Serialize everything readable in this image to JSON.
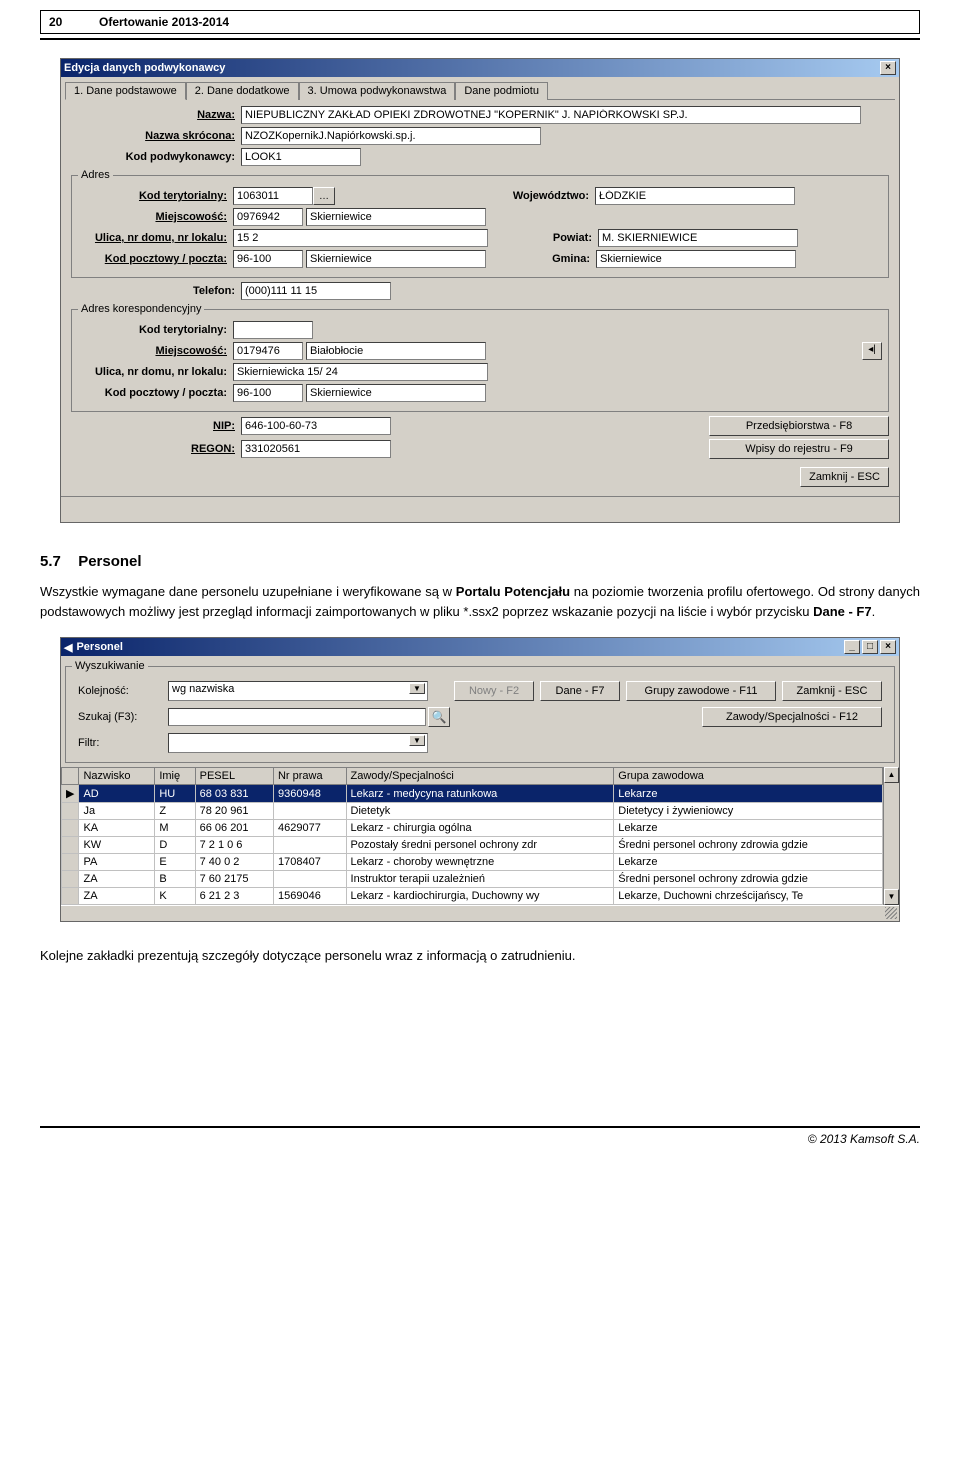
{
  "page_header": {
    "number": "20",
    "title": "Ofertowanie 2013-2014"
  },
  "win1": {
    "title": "Edycja danych podwykonawcy",
    "tabs": [
      "1. Dane podstawowe",
      "2. Dane dodatkowe",
      "3. Umowa podwykonawstwa",
      "Dane podmiotu"
    ],
    "labels": {
      "nazwa": "Nazwa:",
      "nazwa_skr": "Nazwa skrócona:",
      "kod_pod": "Kod podwykonawcy:",
      "adres": "Adres",
      "kod_ter": "Kod terytorialny:",
      "woj": "Województwo:",
      "miejsc": "Miejscowość:",
      "ulica": "Ulica, nr domu, nr lokalu:",
      "powiat": "Powiat:",
      "kod_poczta": "Kod pocztowy / poczta:",
      "gmina": "Gmina:",
      "telefon": "Telefon:",
      "adres_kor": "Adres korespondencyjny",
      "nip": "NIP:",
      "regon": "REGON:"
    },
    "values": {
      "nazwa": "NIEPUBLICZNY ZAKŁAD OPIEKI ZDROWOTNEJ \"KOPERNIK\" J. NAPIÓRKOWSKI SP.J.",
      "nazwa_skr": "NZOZKopernikJ.Napiórkowski.sp.j.",
      "kod_pod": "LOOK1",
      "kod_ter": "1063011",
      "woj": "ŁÓDZKIE",
      "miejsc_code": "0976942",
      "miejsc_name": "Skierniewice",
      "ulica": "15 2",
      "powiat": "M. SKIERNIEWICE",
      "kod_pocz": "96-100",
      "poczta": "Skierniewice",
      "gmina": "Skierniewice",
      "telefon": "(000)111 11 15",
      "kor_miejsc_code": "0179476",
      "kor_miejsc_name": "Białobłocie",
      "kor_ulica": "Skierniewicka 15/ 24",
      "kor_kod": "96-100",
      "kor_poczta": "Skierniewice",
      "nip": "646-100-60-73",
      "regon": "331020561"
    },
    "buttons": {
      "f8": "Przedsiębiorstwa - F8",
      "f9": "Wpisy do rejestru - F9",
      "esc": "Zamknij - ESC",
      "dots": "…"
    }
  },
  "section": {
    "num": "5.7",
    "title": "Personel"
  },
  "para1_a": "Wszystkie wymagane dane personelu uzupełniane i weryfikowane są w ",
  "para1_b": "Portalu Potencjału",
  "para1_c": " na poziomie tworzenia profilu ofertowego. Od strony danych podstawowych możliwy jest przegląd informacji zaimportowanych w pliku *.ssx2 poprzez wskazanie pozycji na liście i wybór przycisku ",
  "para1_d": "Dane - F7",
  "para1_e": ".",
  "win2": {
    "title": "Personel",
    "group": "Wyszukiwanie",
    "kolejnosc_lbl": "Kolejność:",
    "kolejnosc_val": "wg nazwiska",
    "szukaj_lbl": "Szukaj (F3):",
    "filtr_lbl": "Filtr:",
    "btn_nowy": "Nowy - F2",
    "btn_dane": "Dane - F7",
    "btn_grupy": "Grupy zawodowe - F11",
    "btn_zamknij": "Zamknij - ESC",
    "btn_zawody": "Zawody/Specjalności - F12",
    "cols": [
      "Nazwisko",
      "Imię",
      "PESEL",
      "Nr prawa",
      "Zawody/Specjalności",
      "Grupa zawodowa"
    ],
    "rows": [
      {
        "nazwisko": "AD",
        "imie": "HU",
        "pesel": "68   03   831",
        "nr": "9360948",
        "zaw": "Lekarz - medycyna ratunkowa",
        "grupa": "Lekarze"
      },
      {
        "nazwisko": "Ja",
        "imie": "Z",
        "pesel": "78   20   961",
        "nr": "",
        "zaw": "Dietetyk",
        "grupa": "Dietetycy i żywieniowcy"
      },
      {
        "nazwisko": "KA",
        "imie": "M",
        "pesel": "66   06   201",
        "nr": "4629077",
        "zaw": "Lekarz - chirurgia ogólna",
        "grupa": "Lekarze"
      },
      {
        "nazwisko": "KW",
        "imie": "D",
        "pesel": "7    2 1   0   6",
        "nr": "",
        "zaw": "Pozostały średni personel ochrony zdr",
        "grupa": "Średni personel ochrony zdrowia gdzie"
      },
      {
        "nazwisko": "PA",
        "imie": "E",
        "pesel": "7   40    0   2",
        "nr": "1708407",
        "zaw": "Lekarz - choroby wewnętrzne",
        "grupa": "Lekarze"
      },
      {
        "nazwisko": "ZA",
        "imie": "B",
        "pesel": "7   60   2175",
        "nr": "",
        "zaw": "Instruktor terapii uzależnień",
        "grupa": "Średni personel ochrony zdrowia gdzie"
      },
      {
        "nazwisko": "ZA",
        "imie": "K",
        "pesel": "6   21    2   3",
        "nr": "1569046",
        "zaw": "Lekarz - kardiochirurgia, Duchowny wy",
        "grupa": "Lekarze, Duchowni chrześcijańscy, Te"
      }
    ]
  },
  "para2": "Kolejne zakładki prezentują szczegóły dotyczące personelu wraz z informacją o zatrudnieniu.",
  "footer": "© 2013 Kamsoft S.A."
}
